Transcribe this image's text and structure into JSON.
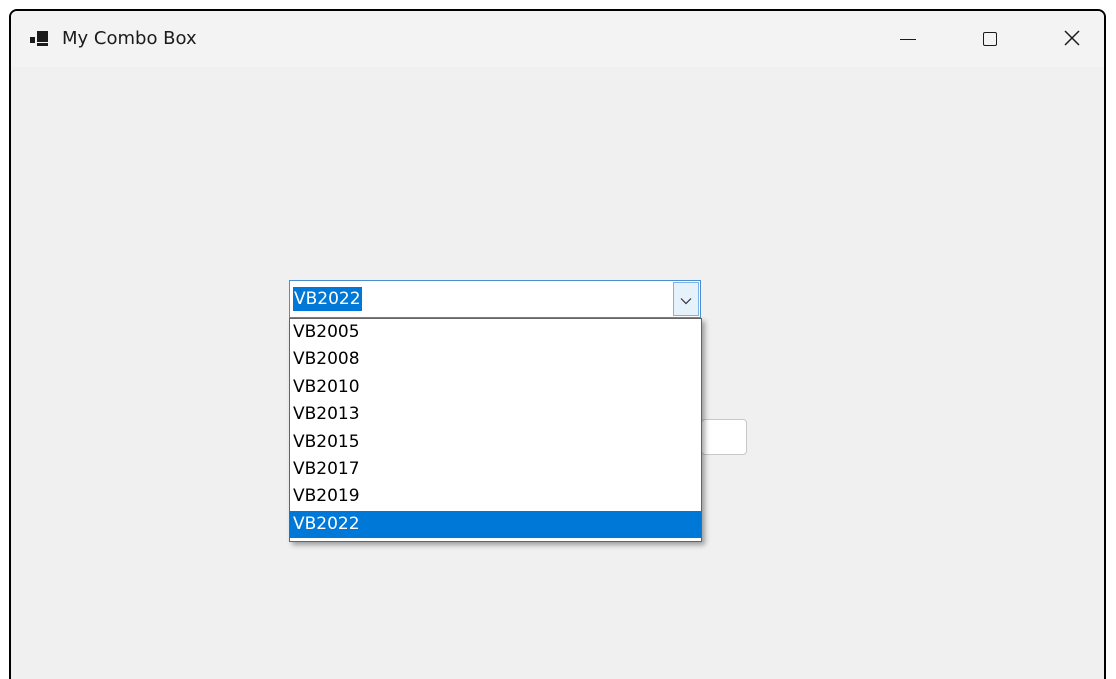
{
  "window": {
    "title": "My Combo Box",
    "controls": {
      "minimize": "minimize-icon",
      "maximize": "maximize-icon",
      "close": "close-icon"
    }
  },
  "combo": {
    "value": "VB2022",
    "items": [
      {
        "label": "VB2005",
        "selected": false
      },
      {
        "label": "VB2008",
        "selected": false
      },
      {
        "label": "VB2010",
        "selected": false
      },
      {
        "label": "VB2013",
        "selected": false
      },
      {
        "label": "VB2015",
        "selected": false
      },
      {
        "label": "VB2017",
        "selected": false
      },
      {
        "label": "VB2019",
        "selected": false
      },
      {
        "label": "VB2022",
        "selected": true
      }
    ]
  },
  "colors": {
    "selection": "#0078d7",
    "window_bg": "#f0f0f0",
    "combo_border": "#4a8fd0"
  }
}
